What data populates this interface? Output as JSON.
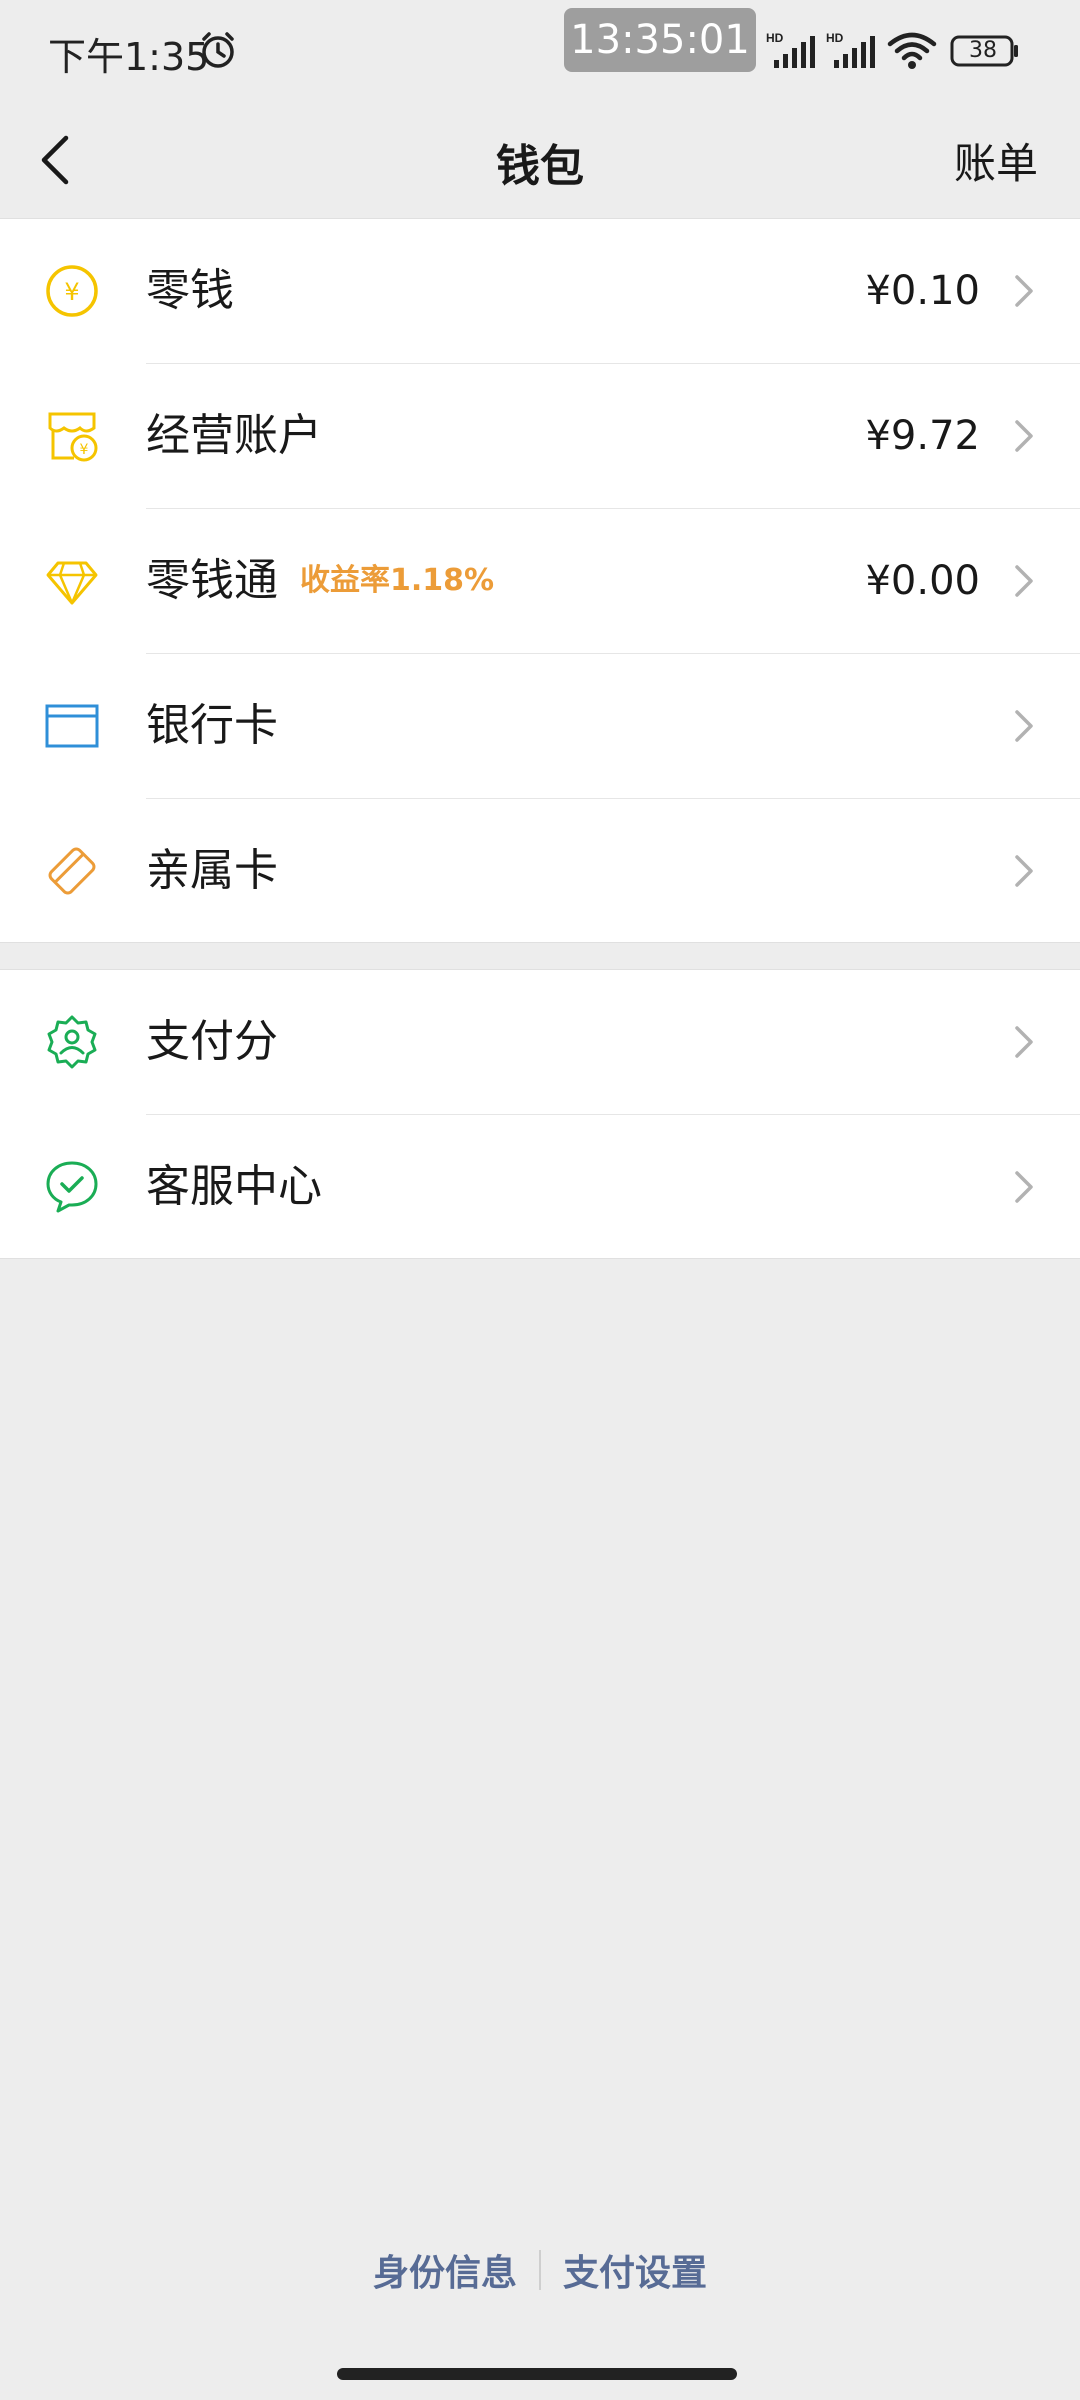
{
  "status_bar": {
    "time": "下午1:35",
    "clock_overlay": "13:35:01",
    "battery": "38",
    "signal_label": "HD"
  },
  "nav": {
    "title": "钱包",
    "right_action": "账单"
  },
  "group1": [
    {
      "label": "零钱",
      "value": "¥0.10",
      "icon": "yuan-coin-icon",
      "color": "#f5c400"
    },
    {
      "label": "经营账户",
      "value": "¥9.72",
      "icon": "shop-account-icon",
      "color": "#f5c400"
    },
    {
      "label": "零钱通",
      "badge": "收益率1.18%",
      "value": "¥0.00",
      "icon": "diamond-icon",
      "color": "#f5c400"
    },
    {
      "label": "银行卡",
      "icon": "bank-card-icon",
      "color": "#2f8fd8"
    },
    {
      "label": "亲属卡",
      "icon": "family-card-icon",
      "color": "#ec9c38"
    }
  ],
  "group2": [
    {
      "label": "支付分",
      "icon": "pay-score-icon",
      "color": "#1aad55"
    },
    {
      "label": "客服中心",
      "icon": "customer-service-icon",
      "color": "#1aad55"
    }
  ],
  "footer": {
    "identity": "身份信息",
    "pay_settings": "支付设置"
  },
  "colors": {
    "link": "#576b95",
    "badge": "#ec9c38",
    "background": "#ededed"
  }
}
